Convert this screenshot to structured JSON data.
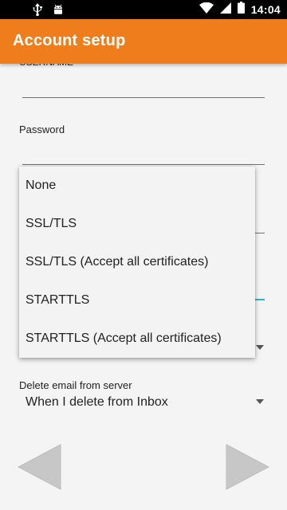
{
  "status_bar": {
    "time": "14:04",
    "icons": [
      "usb-icon",
      "android-icon",
      "wifi-icon",
      "signal-icon",
      "battery-icon"
    ]
  },
  "app_bar": {
    "title": "Account setup"
  },
  "form": {
    "username_label": "USERNAME",
    "password_label": "Password",
    "delete_label": "Delete email from server",
    "delete_value": "When I delete from Inbox"
  },
  "security_dropdown": {
    "options": [
      "None",
      "SSL/TLS",
      "SSL/TLS (Accept all certificates)",
      "STARTTLS",
      "STARTTLS (Accept all certificates)"
    ]
  },
  "nav": {
    "back_icon": "back-arrow-icon",
    "next_icon": "next-arrow-icon"
  },
  "colors": {
    "accent": "#ef7d1c",
    "focus": "#29b6c6",
    "status_bar": "#000000",
    "background": "#f4f4f4"
  }
}
